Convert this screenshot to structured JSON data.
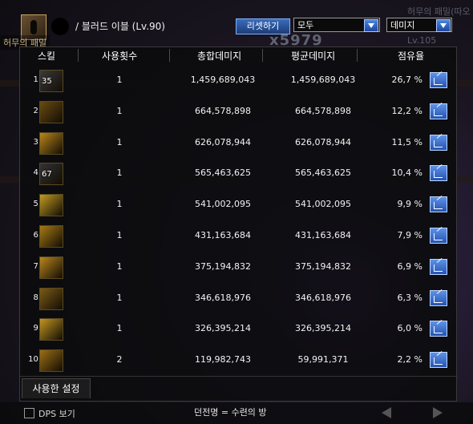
{
  "header": {
    "character_name": "/ 블러드 이블 (Lv.90)",
    "guild_tag": "허무의 패밀",
    "reset_label": "리셋하기",
    "filter_select": "모두",
    "metric_select": "데미지",
    "damage_overlay": "x5979",
    "ghost_right_title": "허무의 패밀(따오",
    "ghost_right_level": "Lv.105"
  },
  "columns": {
    "skill": "스킬",
    "uses": "사용횟수",
    "total": "총합데미지",
    "avg": "평균데미지",
    "share": "점유율"
  },
  "rows": [
    {
      "idx": "1.",
      "icon_label": "35",
      "icon_color": "#3a3a3a",
      "uses": "1",
      "total": "1,459,689,043",
      "avg": "1,459,689,043",
      "share": "26,7 %"
    },
    {
      "idx": "2.",
      "icon_label": "",
      "icon_color": "#6a4a12",
      "uses": "1",
      "total": "664,578,898",
      "avg": "664,578,898",
      "share": "12,2 %"
    },
    {
      "idx": "3.",
      "icon_label": "",
      "icon_color": "#b9861a",
      "uses": "1",
      "total": "626,078,944",
      "avg": "626,078,944",
      "share": "11,5 %"
    },
    {
      "idx": "4.",
      "icon_label": "67",
      "icon_color": "#333333",
      "uses": "1",
      "total": "565,463,625",
      "avg": "565,463,625",
      "share": "10,4 %"
    },
    {
      "idx": "5.",
      "icon_label": "",
      "icon_color": "#c29a22",
      "uses": "1",
      "total": "541,002,095",
      "avg": "541,002,095",
      "share": "9,9 %"
    },
    {
      "idx": "6.",
      "icon_label": "",
      "icon_color": "#a77a14",
      "uses": "1",
      "total": "431,163,684",
      "avg": "431,163,684",
      "share": "7,9 %"
    },
    {
      "idx": "7.",
      "icon_label": "",
      "icon_color": "#b8861c",
      "uses": "1",
      "total": "375,194,832",
      "avg": "375,194,832",
      "share": "6,9 %"
    },
    {
      "idx": "8.",
      "icon_label": "",
      "icon_color": "#7c5a15",
      "uses": "1",
      "total": "346,618,976",
      "avg": "346,618,976",
      "share": "6,3 %"
    },
    {
      "idx": "9.",
      "icon_label": "",
      "icon_color": "#c19620",
      "uses": "1",
      "total": "326,395,214",
      "avg": "326,395,214",
      "share": "6,0 %"
    },
    {
      "idx": "10.",
      "icon_label": "",
      "icon_color": "#9c6f14",
      "uses": "2",
      "total": "119,982,743",
      "avg": "59,991,371",
      "share": "2,2 %"
    }
  ],
  "settings": {
    "tab_label": "사용한 설정"
  },
  "footer": {
    "dps_label": "DPS 보기",
    "dungeon_label": "던전명 = 수련의 방"
  }
}
